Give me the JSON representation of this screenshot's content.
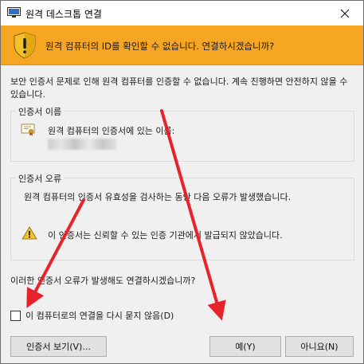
{
  "window": {
    "title": "원격 데스크톱 연결",
    "close_symbol": "✕"
  },
  "banner": {
    "message": "원격 컴퓨터의 ID를 확인할 수 없습니다. 연결하시겠습니까?",
    "color": "#f6a623"
  },
  "intro_text": "보안 인증서 문제로 인해 원격 컴퓨터를 인증할 수 없습니다. 계속 진행하면 안전하지 않을 수 있습니다.",
  "cert_name_group": {
    "title": "인증서 이름",
    "label": "원격 컴퓨터의 인증서에 있는 이름:"
  },
  "cert_error_group": {
    "title": "인증서 오류",
    "description": "원격 컴퓨터의 인증서 유효성을 검사하는 동안 다음 오류가 발생했습니다.",
    "error_item": "이 인증서는 신뢰할 수 있는 인증 기관에서 발급되지 않았습니다."
  },
  "question": "이러한 인증서 오류가 발생해도 연결하시겠습니까?",
  "checkbox": {
    "label": "이 컴퓨터로의 연결을 다시 묻지 않음(D)",
    "checked": false
  },
  "buttons": {
    "view_cert": "인증서 보기(V)...",
    "yes": "예(Y)",
    "no": "아니요(N)"
  },
  "annotation_color": "#e8222a"
}
